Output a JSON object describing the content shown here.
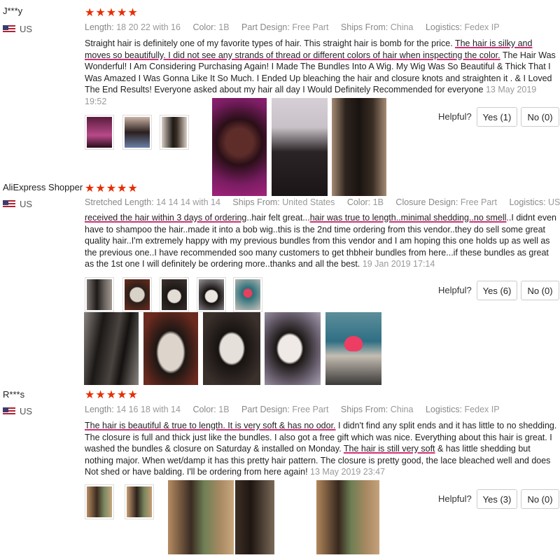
{
  "reviews": [
    {
      "user": "J***y",
      "country": "US",
      "stars": "★★★★★",
      "meta": [
        {
          "label": "Length:",
          "value": "18 20 22 with 16"
        },
        {
          "label": "Color:",
          "value": "1B"
        },
        {
          "label": "Part Design:",
          "value": "Free Part"
        },
        {
          "label": "Ships From:",
          "value": "China"
        },
        {
          "label": "Logistics:",
          "value": "Fedex IP"
        }
      ],
      "text": [
        {
          "t": "Straight hair is definitely one of my favorite types of hair. This straight hair is bomb for the price. ",
          "u": false
        },
        {
          "t": "The hair is silky and moves so beautifully. I did not see any strands of thread or different colors of hair when inspecting the color.",
          "u": true
        },
        {
          "t": " The Hair Was Wonderful! I Am Considering Purchasing Again! I Made The Bundles Into A Wig. My Wig Was So Beautiful & Thick That I Was Amazed I Was Gonna Like It So Much. I Ended Up bleaching the hair and closure knots and straighten it . & I Loved The End Results! Everyone asked about my hair all day I Would Definitely Recommended for everyone ",
          "u": false
        }
      ],
      "date": "13 May 2019 19:52",
      "helpful": "Helpful?",
      "yes": "Yes (1)",
      "no": "No (0)"
    },
    {
      "user": "AliExpress Shopper",
      "country": "US",
      "stars": "★★★★★",
      "meta": [
        {
          "label": "Stretched Length:",
          "value": "14 14 14 with 14"
        },
        {
          "label": "Ships From:",
          "value": "United States"
        },
        {
          "label": "Color:",
          "value": "1B"
        },
        {
          "label": "Closure Design:",
          "value": "Free Part"
        },
        {
          "label": "Logistics:",
          "value": "USPS"
        }
      ],
      "text": [
        {
          "t": "received the hair within 3 days of ordering",
          "u": true
        },
        {
          "t": "..hair felt great...",
          "u": false
        },
        {
          "t": "hair was true to length..minimal shedding..no smell",
          "u": true
        },
        {
          "t": "..I didnt even have to shampoo the hair..made it into a bob wig..this is the 2nd time ordering from this vendor..they do sell some great quality hair..I'm extremely happy with my previous bundles from this vendor and I am hoping this one holds up as well as the previous one..I have recommended soo many customers to get thbheir bundles from here...if these bundles as great as the 1st one I will definitely be ordering more..thanks and all the best. ",
          "u": false
        }
      ],
      "date": "19 Jan 2019 17:14",
      "helpful": "Helpful?",
      "yes": "Yes (6)",
      "no": "No (0)"
    },
    {
      "user": "R***s",
      "country": "US",
      "stars": "★★★★★",
      "meta": [
        {
          "label": "Length:",
          "value": "14 16 18 with 14"
        },
        {
          "label": "Color:",
          "value": "1B"
        },
        {
          "label": "Part Design:",
          "value": "Free Part"
        },
        {
          "label": "Ships From:",
          "value": "China"
        },
        {
          "label": "Logistics:",
          "value": "Fedex IP"
        }
      ],
      "text": [
        {
          "t": "The hair is beautiful & true to length. It is very soft & has no odor.",
          "u": true
        },
        {
          "t": " I didn't find any split ends and it has little to no shedding. The closure is full and thick just like the bundles. I also got a free gift which was nice. Everything about this hair is great. I washed the bundles & closure on Saturday & installed on Monday. ",
          "u": false
        },
        {
          "t": "The hair is still very soft",
          "u": true
        },
        {
          "t": " & has little shedding but nothing major. When wet/damp it has this pretty hair pattern. The closure is pretty good, the lace bleached well and does Not shed or have balding. I'll be ordering from here again! ",
          "u": false
        }
      ],
      "date": "13 May 2019 23:47",
      "helpful": "Helpful?",
      "yes": "Yes (3)",
      "no": "No (0)"
    }
  ],
  "colors": {
    "star": "#e62e04",
    "underline": "#d0307a"
  }
}
